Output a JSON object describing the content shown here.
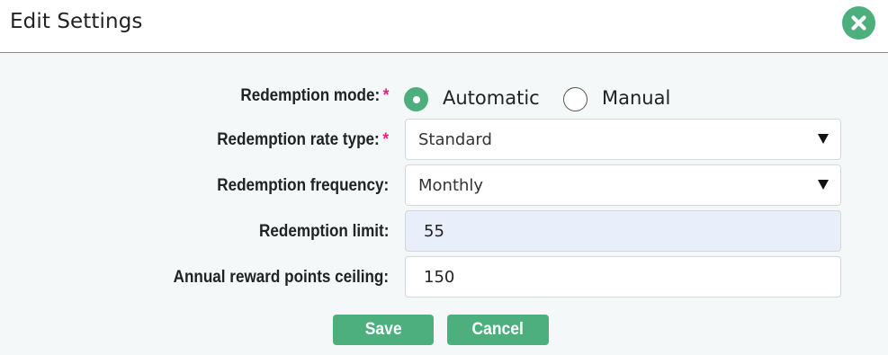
{
  "dialog": {
    "title": "Edit Settings",
    "close_icon": "close-icon",
    "accent_color": "#4caf7d",
    "required_marker": "*",
    "required_color": "#e0217d"
  },
  "form": {
    "redemption_mode": {
      "label": "Redemption mode:",
      "required": true,
      "options": [
        {
          "label": "Automatic",
          "selected": true
        },
        {
          "label": "Manual",
          "selected": false
        }
      ]
    },
    "redemption_rate_type": {
      "label": "Redemption rate type:",
      "required": true,
      "value": "Standard"
    },
    "redemption_frequency": {
      "label": "Redemption frequency:",
      "value": "Monthly"
    },
    "redemption_limit": {
      "label": "Redemption limit:",
      "value": "55"
    },
    "annual_ceiling": {
      "label": "Annual reward points ceiling:",
      "value": "150"
    }
  },
  "actions": {
    "save_label": "Save",
    "cancel_label": "Cancel"
  }
}
